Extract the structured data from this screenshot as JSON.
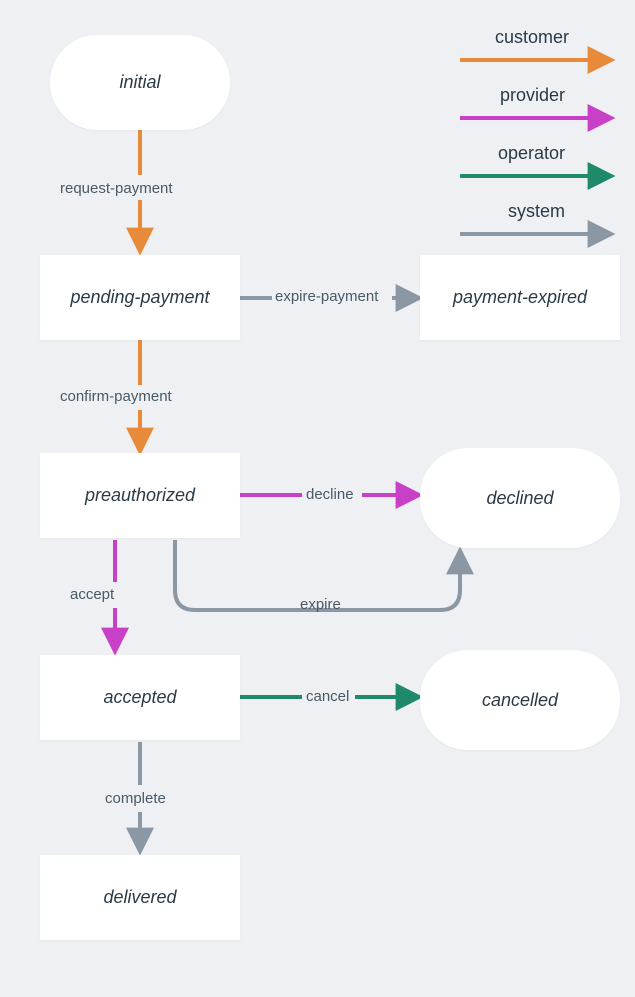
{
  "diagram": {
    "nodes": {
      "initial": "initial",
      "pending_payment": "pending-payment",
      "payment_expired": "payment-expired",
      "preauthorized": "preauthorized",
      "declined": "declined",
      "accepted": "accepted",
      "cancelled": "cancelled",
      "delivered": "delivered"
    },
    "edges": {
      "request_payment": "request-payment",
      "expire_payment": "expire-payment",
      "confirm_payment": "confirm-payment",
      "decline": "decline",
      "accept": "accept",
      "expire": "expire",
      "cancel": "cancel",
      "complete": "complete"
    },
    "legend": {
      "customer": "customer",
      "provider": "provider",
      "operator": "operator",
      "system": "system"
    },
    "colors": {
      "customer": "#e78a3a",
      "provider": "#c740c7",
      "operator": "#1f8a6b",
      "system": "#8b97a2"
    }
  },
  "chart_data": {
    "type": "diagram",
    "nodes": [
      {
        "id": "initial",
        "label": "initial",
        "shape": "pill"
      },
      {
        "id": "pending_payment",
        "label": "pending-payment",
        "shape": "rect"
      },
      {
        "id": "payment_expired",
        "label": "payment-expired",
        "shape": "rect"
      },
      {
        "id": "preauthorized",
        "label": "preauthorized",
        "shape": "rect"
      },
      {
        "id": "declined",
        "label": "declined",
        "shape": "pill"
      },
      {
        "id": "accepted",
        "label": "accepted",
        "shape": "rect"
      },
      {
        "id": "cancelled",
        "label": "cancelled",
        "shape": "pill"
      },
      {
        "id": "delivered",
        "label": "delivered",
        "shape": "rect"
      }
    ],
    "edges": [
      {
        "from": "initial",
        "to": "pending_payment",
        "label": "request-payment",
        "actor": "customer"
      },
      {
        "from": "pending_payment",
        "to": "payment_expired",
        "label": "expire-payment",
        "actor": "system"
      },
      {
        "from": "pending_payment",
        "to": "preauthorized",
        "label": "confirm-payment",
        "actor": "customer"
      },
      {
        "from": "preauthorized",
        "to": "declined",
        "label": "decline",
        "actor": "provider"
      },
      {
        "from": "preauthorized",
        "to": "accepted",
        "label": "accept",
        "actor": "provider"
      },
      {
        "from": "preauthorized",
        "to": "declined",
        "label": "expire",
        "actor": "system"
      },
      {
        "from": "accepted",
        "to": "cancelled",
        "label": "cancel",
        "actor": "operator"
      },
      {
        "from": "accepted",
        "to": "delivered",
        "label": "complete",
        "actor": "system"
      }
    ],
    "legend_actors": [
      {
        "actor": "customer",
        "color": "#e78a3a"
      },
      {
        "actor": "provider",
        "color": "#c740c7"
      },
      {
        "actor": "operator",
        "color": "#1f8a6b"
      },
      {
        "actor": "system",
        "color": "#8b97a2"
      }
    ]
  }
}
